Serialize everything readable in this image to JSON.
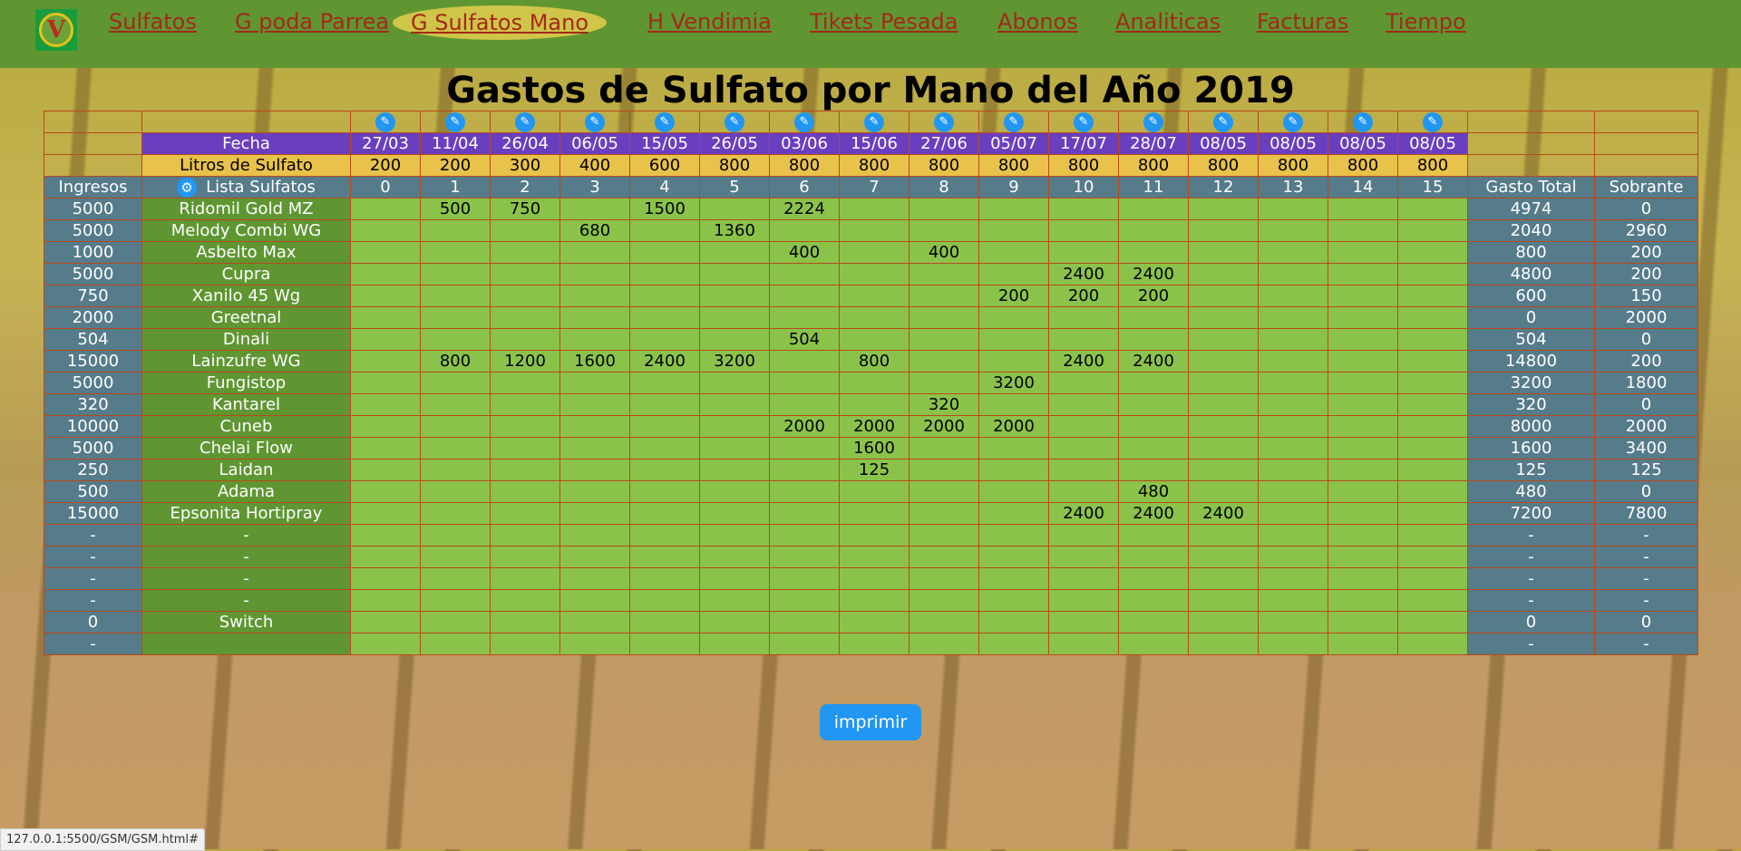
{
  "nav": {
    "logo_letter": "V",
    "links": [
      "Sulfatos",
      "G poda Parrea",
      "G Sulfatos Mano",
      "H Vendimia",
      "Tikets Pesada",
      "Abonos",
      "Analiticas",
      "Facturas",
      "Tiempo"
    ],
    "active_index": 2
  },
  "page_title": "Gastos de Sulfato por Mano del Año 2019",
  "table": {
    "fecha_label": "Fecha",
    "litros_label": "Litros de Sulfato",
    "ingresos_label": "Ingresos",
    "lista_label": "Lista Sulfatos",
    "gasto_label": "Gasto Total",
    "sobrante_label": "Sobrante",
    "dates": [
      "27/03",
      "11/04",
      "26/04",
      "06/05",
      "15/05",
      "26/05",
      "03/06",
      "15/06",
      "27/06",
      "05/07",
      "17/07",
      "28/07",
      "08/05",
      "08/05",
      "08/05",
      "08/05"
    ],
    "litros": [
      "200",
      "200",
      "300",
      "400",
      "600",
      "800",
      "800",
      "800",
      "800",
      "800",
      "800",
      "800",
      "800",
      "800",
      "800",
      "800"
    ],
    "col_numbers": [
      "0",
      "1",
      "2",
      "3",
      "4",
      "5",
      "6",
      "7",
      "8",
      "9",
      "10",
      "11",
      "12",
      "13",
      "14",
      "15"
    ],
    "rows": [
      {
        "ingresos": "5000",
        "name": "Ridomil Gold MZ",
        "cells": [
          "",
          "500",
          "750",
          "",
          "1500",
          "",
          "2224",
          "",
          "",
          "",
          "",
          "",
          "",
          "",
          "",
          ""
        ],
        "gasto": "4974",
        "sobrante": "0"
      },
      {
        "ingresos": "5000",
        "name": "Melody Combi WG",
        "cells": [
          "",
          "",
          "",
          "680",
          "",
          "1360",
          "",
          "",
          "",
          "",
          "",
          "",
          "",
          "",
          "",
          ""
        ],
        "gasto": "2040",
        "sobrante": "2960"
      },
      {
        "ingresos": "1000",
        "name": "Asbelto Max",
        "cells": [
          "",
          "",
          "",
          "",
          "",
          "",
          "400",
          "",
          "400",
          "",
          "",
          "",
          "",
          "",
          "",
          ""
        ],
        "gasto": "800",
        "sobrante": "200"
      },
      {
        "ingresos": "5000",
        "name": "Cupra",
        "cells": [
          "",
          "",
          "",
          "",
          "",
          "",
          "",
          "",
          "",
          "",
          "2400",
          "2400",
          "",
          "",
          "",
          ""
        ],
        "gasto": "4800",
        "sobrante": "200"
      },
      {
        "ingresos": "750",
        "name": "Xanilo 45 Wg",
        "cells": [
          "",
          "",
          "",
          "",
          "",
          "",
          "",
          "",
          "",
          "200",
          "200",
          "200",
          "",
          "",
          "",
          ""
        ],
        "gasto": "600",
        "sobrante": "150"
      },
      {
        "ingresos": "2000",
        "name": "Greetnal",
        "cells": [
          "",
          "",
          "",
          "",
          "",
          "",
          "",
          "",
          "",
          "",
          "",
          "",
          "",
          "",
          "",
          ""
        ],
        "gasto": "0",
        "sobrante": "2000"
      },
      {
        "ingresos": "504",
        "name": "Dinali",
        "cells": [
          "",
          "",
          "",
          "",
          "",
          "",
          "504",
          "",
          "",
          "",
          "",
          "",
          "",
          "",
          "",
          ""
        ],
        "gasto": "504",
        "sobrante": "0"
      },
      {
        "ingresos": "15000",
        "name": "Lainzufre WG",
        "cells": [
          "",
          "800",
          "1200",
          "1600",
          "2400",
          "3200",
          "",
          "800",
          "",
          "",
          "2400",
          "2400",
          "",
          "",
          "",
          ""
        ],
        "gasto": "14800",
        "sobrante": "200"
      },
      {
        "ingresos": "5000",
        "name": "Fungistop",
        "cells": [
          "",
          "",
          "",
          "",
          "",
          "",
          "",
          "",
          "",
          "3200",
          "",
          "",
          "",
          "",
          "",
          ""
        ],
        "gasto": "3200",
        "sobrante": "1800"
      },
      {
        "ingresos": "320",
        "name": "Kantarel",
        "cells": [
          "",
          "",
          "",
          "",
          "",
          "",
          "",
          "",
          "320",
          "",
          "",
          "",
          "",
          "",
          "",
          ""
        ],
        "gasto": "320",
        "sobrante": "0"
      },
      {
        "ingresos": "10000",
        "name": "Cuneb",
        "cells": [
          "",
          "",
          "",
          "",
          "",
          "",
          "2000",
          "2000",
          "2000",
          "2000",
          "",
          "",
          "",
          "",
          "",
          ""
        ],
        "gasto": "8000",
        "sobrante": "2000"
      },
      {
        "ingresos": "5000",
        "name": "Chelai Flow",
        "cells": [
          "",
          "",
          "",
          "",
          "",
          "",
          "",
          "1600",
          "",
          "",
          "",
          "",
          "",
          "",
          "",
          ""
        ],
        "gasto": "1600",
        "sobrante": "3400"
      },
      {
        "ingresos": "250",
        "name": "Laidan",
        "cells": [
          "",
          "",
          "",
          "",
          "",
          "",
          "",
          "125",
          "",
          "",
          "",
          "",
          "",
          "",
          "",
          ""
        ],
        "gasto": "125",
        "sobrante": "125"
      },
      {
        "ingresos": "500",
        "name": "Adama",
        "cells": [
          "",
          "",
          "",
          "",
          "",
          "",
          "",
          "",
          "",
          "",
          "",
          "480",
          "",
          "",
          "",
          ""
        ],
        "gasto": "480",
        "sobrante": "0"
      },
      {
        "ingresos": "15000",
        "name": "Epsonita Hortipray",
        "cells": [
          "",
          "",
          "",
          "",
          "",
          "",
          "",
          "",
          "",
          "",
          "2400",
          "2400",
          "2400",
          "",
          "",
          ""
        ],
        "gasto": "7200",
        "sobrante": "7800"
      },
      {
        "ingresos": "-",
        "name": "-",
        "cells": [
          "",
          "",
          "",
          "",
          "",
          "",
          "",
          "",
          "",
          "",
          "",
          "",
          "",
          "",
          "",
          ""
        ],
        "gasto": "-",
        "sobrante": "-"
      },
      {
        "ingresos": "-",
        "name": "-",
        "cells": [
          "",
          "",
          "",
          "",
          "",
          "",
          "",
          "",
          "",
          "",
          "",
          "",
          "",
          "",
          "",
          ""
        ],
        "gasto": "-",
        "sobrante": "-"
      },
      {
        "ingresos": "-",
        "name": "-",
        "cells": [
          "",
          "",
          "",
          "",
          "",
          "",
          "",
          "",
          "",
          "",
          "",
          "",
          "",
          "",
          "",
          ""
        ],
        "gasto": "-",
        "sobrante": "-"
      },
      {
        "ingresos": "-",
        "name": "-",
        "cells": [
          "",
          "",
          "",
          "",
          "",
          "",
          "",
          "",
          "",
          "",
          "",
          "",
          "",
          "",
          "",
          ""
        ],
        "gasto": "-",
        "sobrante": "-"
      },
      {
        "ingresos": "0",
        "name": "Switch",
        "cells": [
          "",
          "",
          "",
          "",
          "",
          "",
          "",
          "",
          "",
          "",
          "",
          "",
          "",
          "",
          "",
          ""
        ],
        "gasto": "0",
        "sobrante": "0"
      },
      {
        "ingresos": "-",
        "name": "",
        "cells": [
          "",
          "",
          "",
          "",
          "",
          "",
          "",
          "",
          "",
          "",
          "",
          "",
          "",
          "",
          "",
          ""
        ],
        "gasto": "-",
        "sobrante": "-"
      }
    ]
  },
  "print_button": "imprimir",
  "status_url": "127.0.0.1:5500/GSM/GSM.html#"
}
